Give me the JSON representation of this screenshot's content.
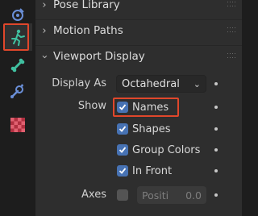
{
  "tabs": [
    {
      "icon": "bone-constraint-icon"
    },
    {
      "icon": "armature-data-icon"
    },
    {
      "icon": "bone-icon"
    },
    {
      "icon": "bone-properties-icon"
    },
    {
      "icon": "texture-icon"
    }
  ],
  "panels": {
    "pose_library": {
      "title": "Pose Library",
      "expanded": false
    },
    "motion_paths": {
      "title": "Motion Paths",
      "expanded": false
    },
    "viewport_display": {
      "title": "Viewport Display",
      "expanded": true
    }
  },
  "viewport": {
    "display_as_label": "Display As",
    "display_as_value": "Octahedral",
    "show_label": "Show",
    "names": "Names",
    "shapes": "Shapes",
    "group_colors": "Group Colors",
    "in_front": "In Front",
    "axes_label": "Axes",
    "axes_position_label": "Positi",
    "axes_position_value": "0.0"
  },
  "colors": {
    "accent": "#4772b3",
    "highlight": "#e0472b"
  }
}
